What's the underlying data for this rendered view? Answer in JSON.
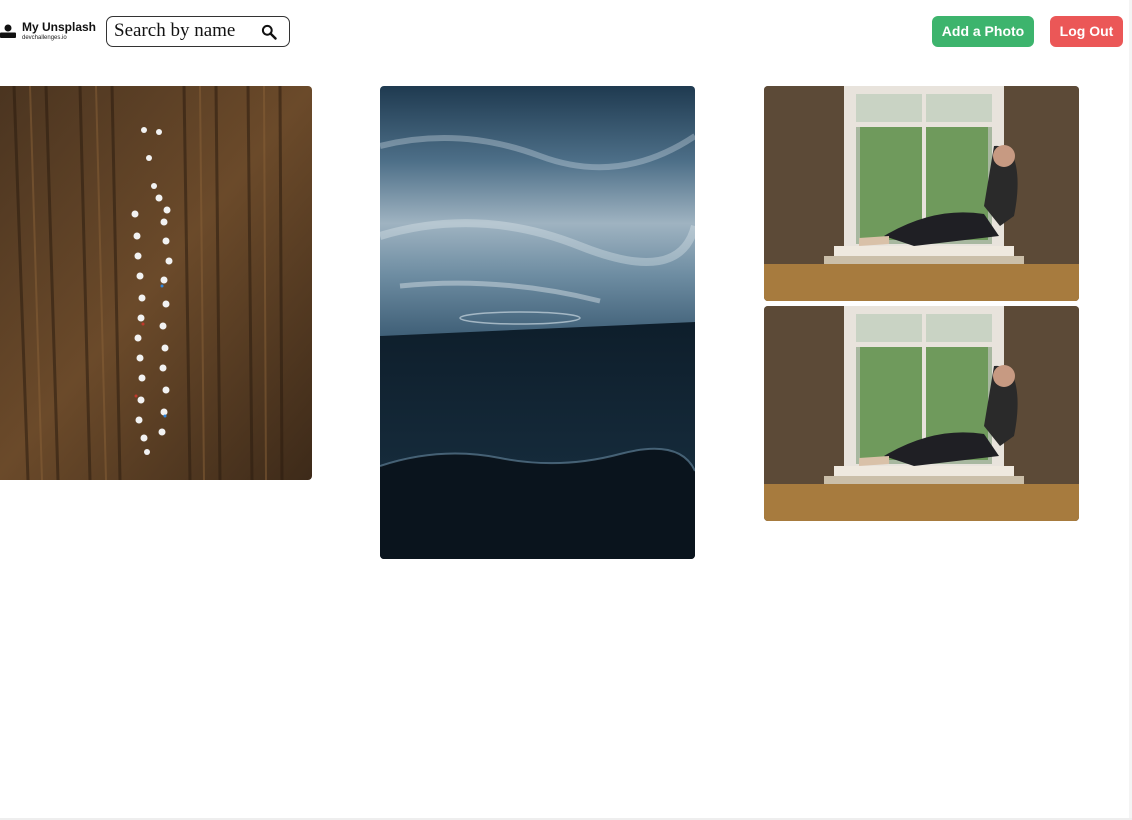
{
  "header": {
    "logo": {
      "name": "My Unsplash",
      "subtitle": "devchallenges.io"
    },
    "search": {
      "placeholder": "Search by name",
      "value": "",
      "icon": "search-icon"
    },
    "buttons": {
      "add_photo": "Add a Photo",
      "log_out": "Log Out"
    }
  },
  "colors": {
    "add_photo": "#3db46d",
    "log_out": "#eb5757",
    "text": "#111111"
  },
  "gallery": {
    "photos": [
      {
        "subject": "aerial field with a line of white tents",
        "column": 1
      },
      {
        "subject": "stormy sky over dark ocean",
        "column": 2
      },
      {
        "subject": "woman sitting on a window sill",
        "column": 3
      },
      {
        "subject": "woman sitting on a window sill",
        "column": 3
      }
    ]
  }
}
